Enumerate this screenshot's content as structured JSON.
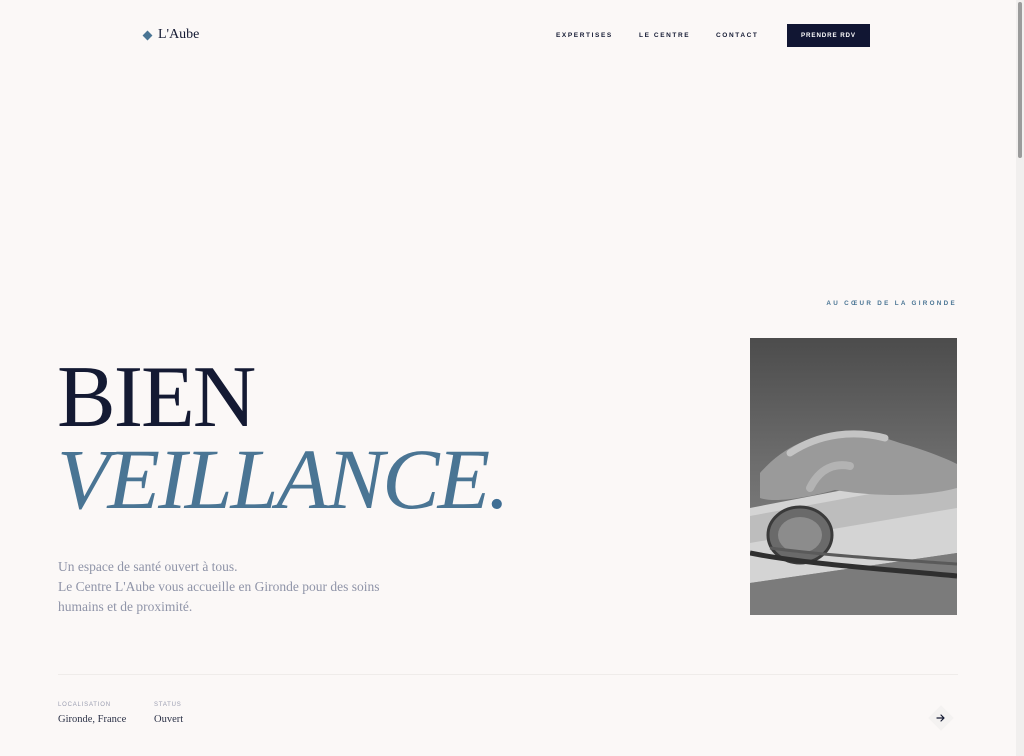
{
  "brand": {
    "name": "L'Aube",
    "icon": "diamond-icon",
    "accent": "#4a7594"
  },
  "nav": {
    "items": [
      "EXPERTISES",
      "LE CENTRE",
      "CONTACT"
    ],
    "cta": "PRENDRE RDV"
  },
  "hero": {
    "eyebrow": "AU CŒUR DE LA GIRONDE",
    "title_line1": "BIEN",
    "title_line2": "VEILLANCE",
    "title_dot": ".",
    "intro_lines": [
      "Un espace de santé ouvert à tous.",
      "Le Centre L'Aube vous accueille en Gironde pour des soins",
      "humains et de proximité."
    ]
  },
  "info": {
    "location_label": "LOCALISATION",
    "location_value": "Gironde, France",
    "status_label": "STATUS",
    "status_value": "Ouvert",
    "next_icon": "arrow-right-icon"
  },
  "colors": {
    "background": "#fbf8f7",
    "ink": "#141a33",
    "accent": "#4a7594",
    "cta_bg": "#111633"
  }
}
